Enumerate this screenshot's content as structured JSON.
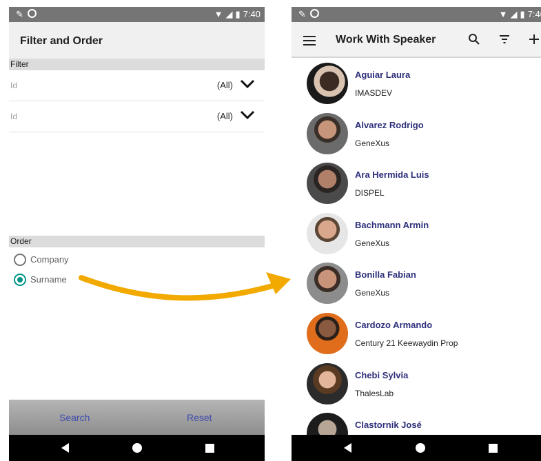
{
  "status_bar": {
    "time": "7:40"
  },
  "filter_screen": {
    "title": "Filter and Order",
    "filter_section": "Filter",
    "filter_rows": [
      {
        "label": "Id",
        "value": "(All)"
      },
      {
        "label": "Id",
        "value": "(All)"
      }
    ],
    "order_section": "Order",
    "order_options": [
      {
        "label": "Company",
        "selected": false
      },
      {
        "label": "Surname",
        "selected": true
      }
    ],
    "search_label": "Search",
    "reset_label": "Reset"
  },
  "speaker_screen": {
    "title": "Work With Speaker",
    "speakers": [
      {
        "name": "Aguiar Laura",
        "company": "IMASDEV"
      },
      {
        "name": "Alvarez Rodrigo",
        "company": "GeneXus"
      },
      {
        "name": "Ara Hermida Luis",
        "company": "DISPEL"
      },
      {
        "name": "Bachmann Armin",
        "company": "GeneXus"
      },
      {
        "name": "Bonilla Fabian",
        "company": "GeneXus"
      },
      {
        "name": "Cardozo Armando",
        "company": "Century 21 Keewaydin Prop"
      },
      {
        "name": "Chebi Sylvia",
        "company": "ThalesLab"
      },
      {
        "name": "Clastornik José",
        "company": ""
      }
    ]
  },
  "icons": {
    "left_status": [
      "pencil-icon",
      "circle-icon"
    ],
    "right_status": [
      "wifi-icon",
      "signal-icon",
      "battery-icon"
    ],
    "appbar": [
      "menu-icon",
      "search-icon",
      "filter-icon",
      "add-icon"
    ],
    "nav": [
      "back-icon",
      "home-icon",
      "recents-icon"
    ]
  },
  "colors": {
    "status_bar": "#757575",
    "accent_radio": "#009688",
    "button_text": "#3f4cb0",
    "speaker_name": "#2d2f7a",
    "arrow": "#f2a900"
  }
}
